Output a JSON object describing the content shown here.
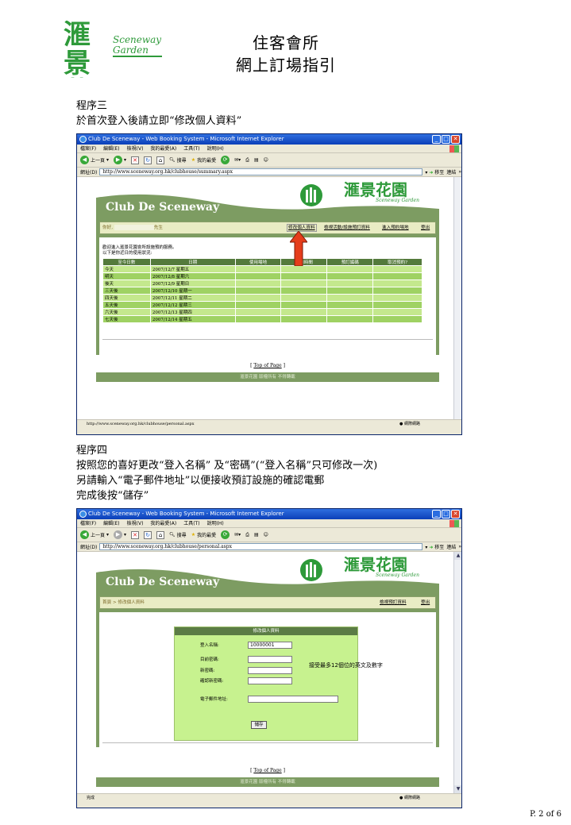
{
  "header": {
    "logo_cn": "滙景花園",
    "logo_en": "Sceneway Garden",
    "title_line1": "住客會所",
    "title_line2": "網上訂場指引"
  },
  "step3": {
    "label": "程序三",
    "instruction": "於首次登入後請立即“修改個人資料”"
  },
  "step4": {
    "label": "程序四",
    "line1": "按照您的喜好更改“登入名稱” 及“密碼”(“登入名稱”只可修改一次)",
    "line2": "另請輸入“電子郵件地址”以便接收預訂設施的確認電郵",
    "line3": "完成後按“儲存”"
  },
  "browser1": {
    "window_title": "Club De Sceneway - Web Booking System - Microsoft Internet Explorer",
    "menu": [
      "檔案(F)",
      "編輯(E)",
      "檢視(V)",
      "我的最愛(A)",
      "工具(T)",
      "說明(H)"
    ],
    "toolbar": {
      "back": "上一頁",
      "search": "搜尋",
      "favorites": "我的最愛"
    },
    "address_label": "網址(D)",
    "address": "http://www.sceneway.org.hk/clubhouse/summary.aspx",
    "go": "移至",
    "links": "連結",
    "status_url": "http://www.sceneway.org.hk/clubhouse/personal.aspx",
    "status_zone": "網際網路"
  },
  "browser2": {
    "window_title": "Club De Sceneway - Web Booking System - Microsoft Internet Explorer",
    "menu": [
      "檔案(F)",
      "編輯(E)",
      "檢視(V)",
      "我的最愛(A)",
      "工具(T)",
      "說明(H)"
    ],
    "toolbar": {
      "back": "上一頁",
      "search": "搜尋",
      "favorites": "我的最愛"
    },
    "address_label": "網址(D)",
    "address": "http://www.sceneway.org.hk/clubhouse/personal.aspx",
    "go": "移至",
    "links": "連結",
    "status_text": "完成",
    "status_zone": "網際網路"
  },
  "site": {
    "club_name": "Club De Sceneway",
    "top_of_page": "Top of Page",
    "footer": "滙景花園 版權所有 不得轉載",
    "logo_cn": "滙景花園",
    "logo_en": "Sceneway Garden"
  },
  "summary_page": {
    "greeting": "你好, ",
    "greeting_suffix": "先生",
    "nav": [
      "修改個人資料",
      "檢視活動/設施預訂資料",
      "進入預約場地",
      "登出"
    ],
    "welcome_line1": "歡迎進入滙景花園會所設施預約服務。",
    "welcome_line2": "以下是你近日的使用狀況:",
    "columns": [
      "至今日數",
      "日期",
      "使用場地",
      "使用時間",
      "預訂編碼",
      "取消預約?"
    ],
    "rows": [
      [
        "今天",
        "2007/12/7 星期五"
      ],
      [
        "明天",
        "2007/12/8 星期六"
      ],
      [
        "後天",
        "2007/12/9 星期日"
      ],
      [
        "三天後",
        "2007/12/10 星期一"
      ],
      [
        "四天後",
        "2007/12/11 星期二"
      ],
      [
        "五天後",
        "2007/12/12 星期三"
      ],
      [
        "六天後",
        "2007/12/13 星期四"
      ],
      [
        "七天後",
        "2007/12/14 星期五"
      ]
    ]
  },
  "personal_page": {
    "breadcrumb": "首頁 > 修改個人資料",
    "nav": [
      "檢視預訂資料",
      "登出"
    ],
    "form_title": "修改個人資料",
    "login_label": "登入名稱:",
    "login_value": "10000001",
    "current_pw_label": "目前密碼:",
    "new_pw_label": "新密碼:",
    "confirm_pw_label": "確認新密碼:",
    "email_label": "電子郵件地址:",
    "save_label": "儲存",
    "hint": "接受最多12個位的英文及數字"
  },
  "page_number": "P. 2 of 6",
  "colors": {
    "arrow": "#e53d1b",
    "site_green": "#7d9c62",
    "logo_green": "#2e9a3a"
  }
}
